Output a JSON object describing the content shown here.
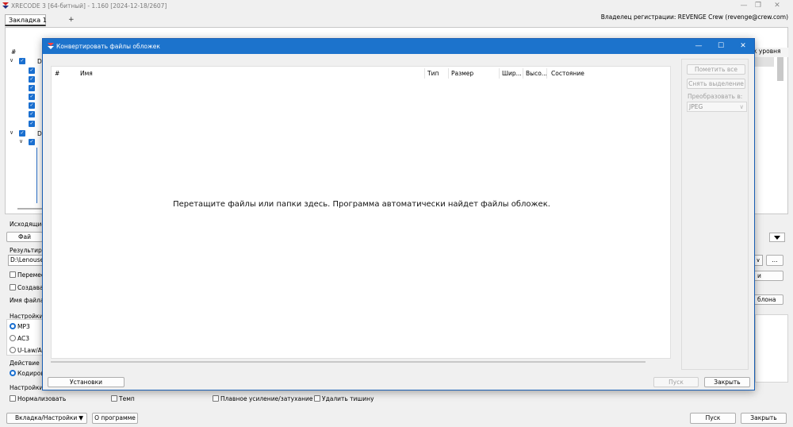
{
  "app": {
    "title": "XRECODE 3 [64-битный] - 1.160 [2024-12-18/2607]",
    "owner": "Владелец регистрации: REVENGE Crew (revenge@crew.com)",
    "controls": {
      "minimize": "—",
      "restore": "❐",
      "close": "✕"
    }
  },
  "tabs": [
    {
      "label": "Закладка 1"
    }
  ],
  "tab_add": "+",
  "main": {
    "col_hash": "#",
    "tree_d1": "D",
    "tree_d2": "D",
    "right_fragment": "к уровня",
    "source_label": "Исходящие",
    "files_btn": "Фай",
    "result_label": "Результиру",
    "path_value": "D:\\Lenouse",
    "browse_btn": "...",
    "move_label": "Перемес",
    "create_label": "Создават",
    "filename_label": "Имя файла:",
    "right_btn_1": "и",
    "right_btn_2": "блона",
    "settings_label": "Настройки р",
    "fmt_mp3": "MP3",
    "fmt_ac3": "AC3",
    "fmt_ulaw": "U-Law/A-",
    "action_label": "Действие",
    "action_value": "Кодирова",
    "extra_settings_label": "Настройки с",
    "opt_normalize": "Нормализовать",
    "opt_tempo": "Темп",
    "opt_fade": "Плавное усиление/затухание",
    "opt_silence": "Удалить тишину",
    "bottom_tab_settings": "Вкладка/Настройки",
    "about_btn": "О программе",
    "start_btn": "Пуск",
    "close_btn": "Закрыть"
  },
  "dialog": {
    "title": "Конвертировать файлы обложек",
    "columns": [
      "#",
      "Имя",
      "Тип",
      "Размер",
      "Шир...",
      "Высо...",
      "Состояние"
    ],
    "drop_hint": "Перетащите файлы или папки здесь. Программа автоматически найдет файлы обложек.",
    "mark_all": "Пометить все",
    "unselect": "Снять выделение",
    "convert_to_label": "Преобразовать в:",
    "format_value": "JPEG",
    "settings_btn": "Установки",
    "start_btn": "Пуск",
    "close_btn": "Закрыть"
  },
  "colors": {
    "accent": "#1c73cc",
    "checkbox": "#1a6fd0"
  },
  "icons": [
    "app-logo-icon",
    "chevron-down-icon",
    "checkbox-checked-icon",
    "dropdown-arrow-icon"
  ]
}
